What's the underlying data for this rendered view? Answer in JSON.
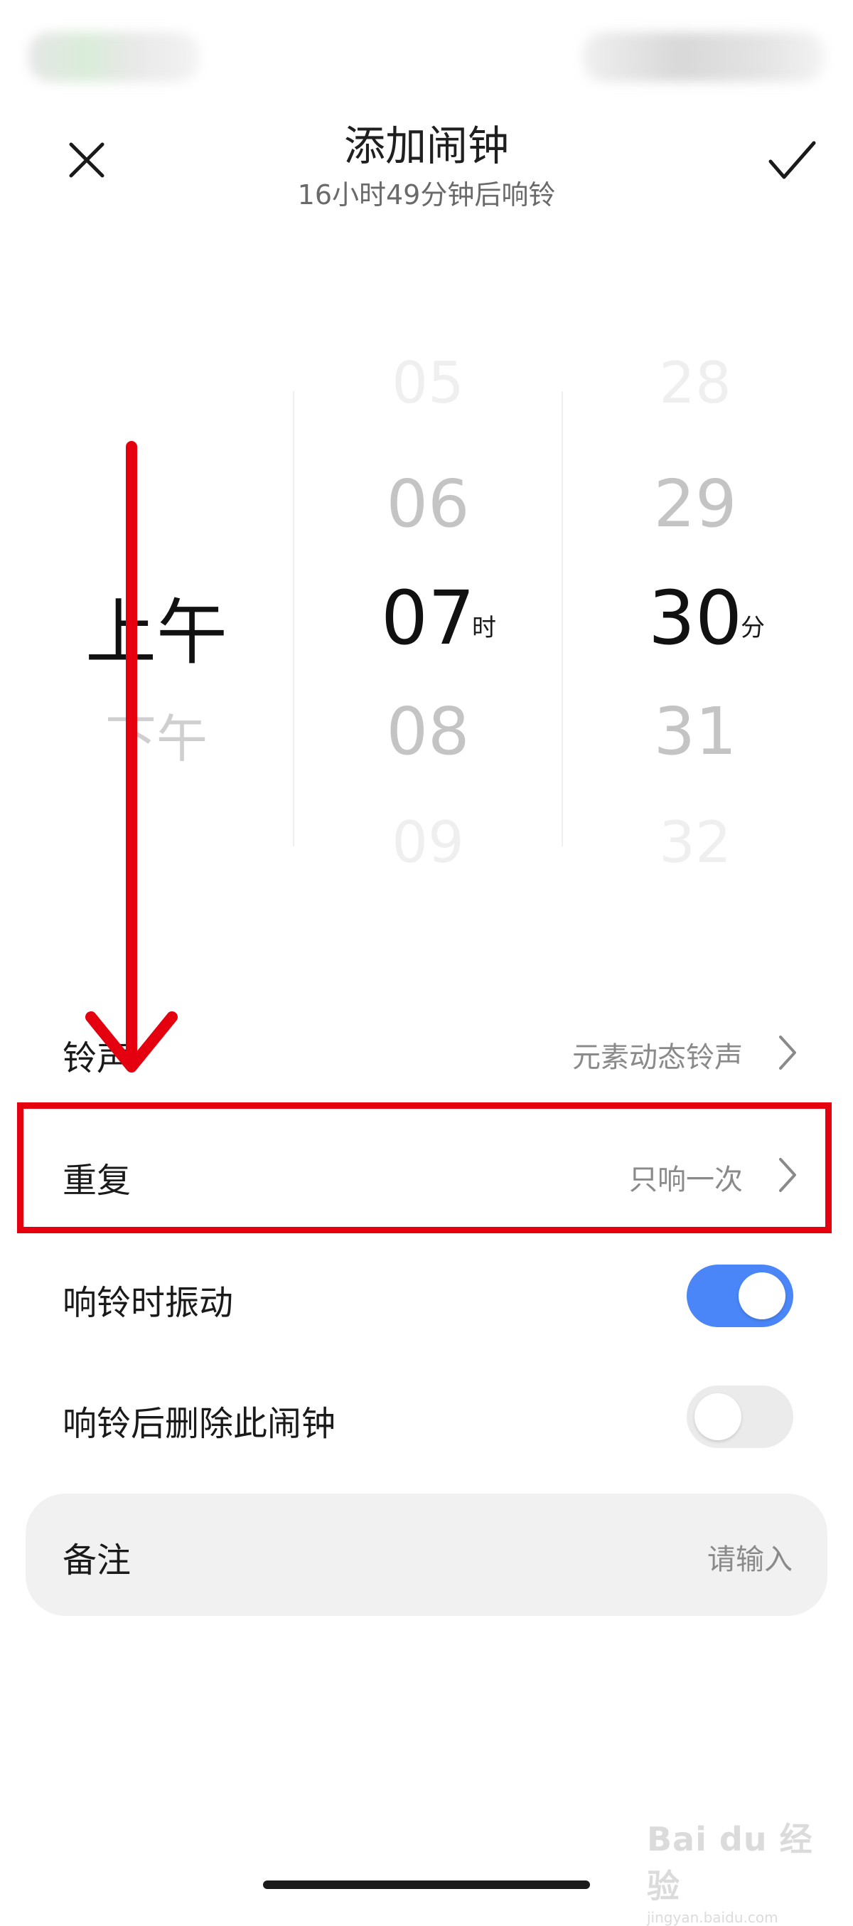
{
  "header": {
    "title": "添加闹钟",
    "subtitle": "16小时49分钟后响铃",
    "close_icon": "close-icon",
    "confirm_icon": "check-icon"
  },
  "picker": {
    "ampm": {
      "selected": "上午",
      "next": "下午"
    },
    "hour": {
      "items": [
        "05",
        "06",
        "07",
        "08",
        "09"
      ],
      "unit": "时"
    },
    "minute": {
      "items": [
        "28",
        "29",
        "30",
        "31",
        "32"
      ],
      "unit": "分"
    }
  },
  "settings": {
    "ringtone": {
      "label": "铃声",
      "value": "元素动态铃声"
    },
    "repeat": {
      "label": "重复",
      "value": "只响一次"
    },
    "vibrate": {
      "label": "响铃时振动",
      "on": true
    },
    "delete_after": {
      "label": "响铃后删除此闹钟",
      "on": false
    },
    "note": {
      "label": "备注",
      "placeholder": "请输入"
    }
  },
  "watermark": {
    "brand": "Bai du 经验",
    "url": "jingyan.baidu.com"
  },
  "colors": {
    "accent": "#4a86f7",
    "annotation": "#e4000f"
  }
}
